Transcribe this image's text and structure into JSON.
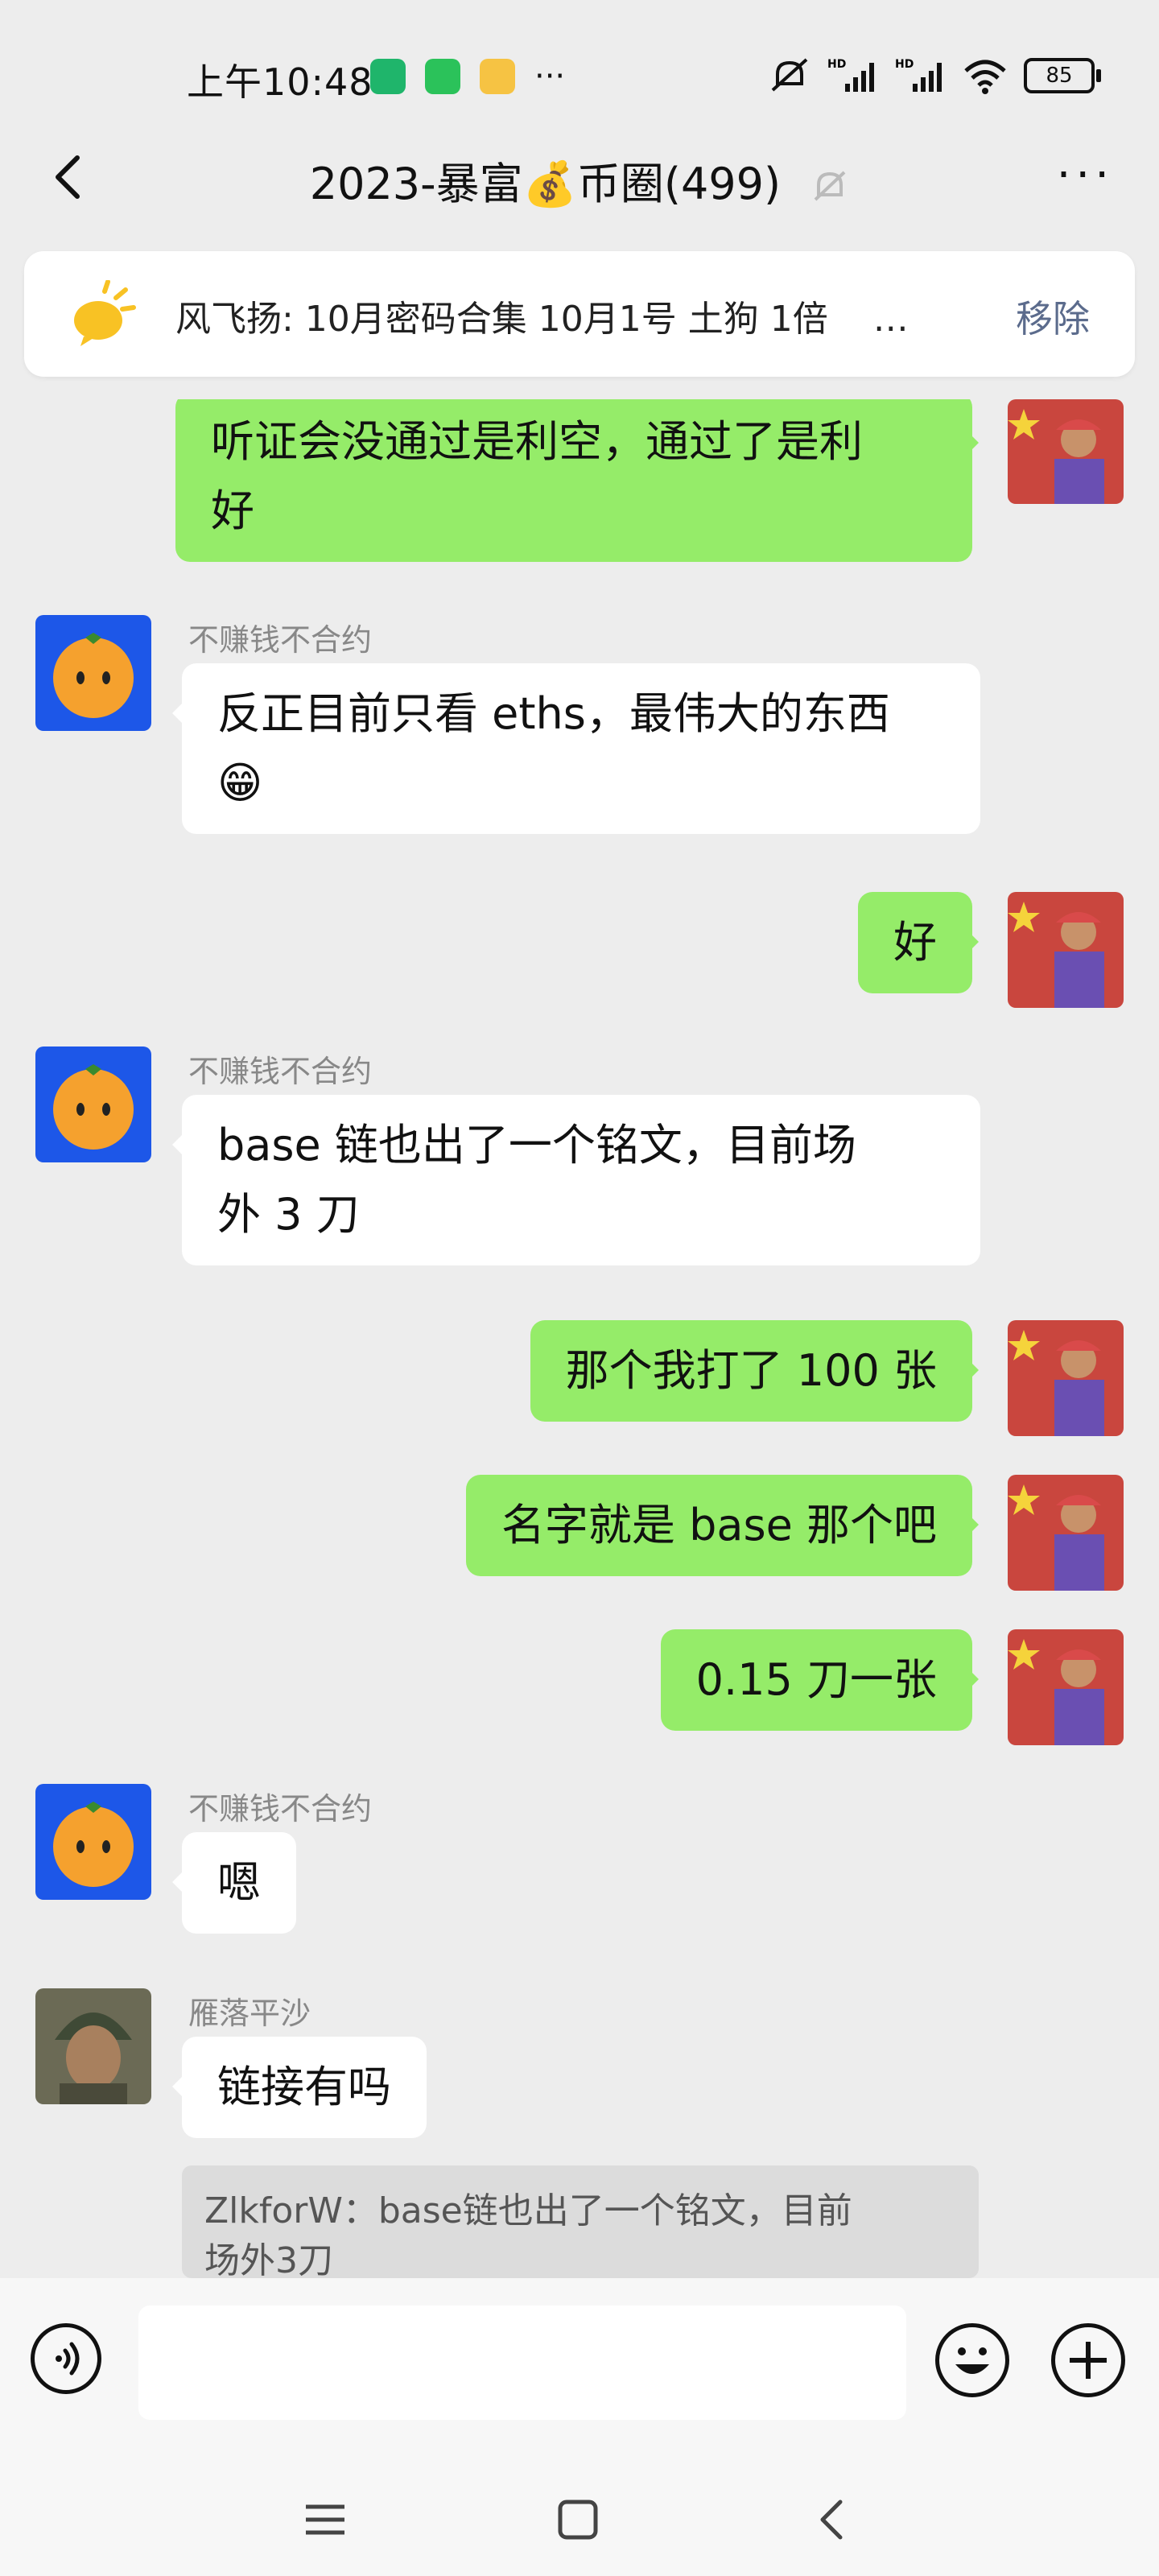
{
  "status_bar": {
    "time": "上午10:48",
    "dots": "···",
    "battery": "85",
    "icons": [
      "shield-app-icon",
      "wechat-icon",
      "notification-app-icon",
      "mute-icon",
      "hd-signal-icon",
      "hd-signal-icon",
      "wifi-icon",
      "battery-icon"
    ]
  },
  "nav": {
    "title": "2023-暴富💰币圈(499)",
    "back_icon": "chevron-left-icon",
    "more_label": "···",
    "mute_icon": "bell-off-icon"
  },
  "pinned": {
    "text": "风飞扬: 10月密码合集 10月1号  土狗   1倍",
    "ellipsis": "…",
    "remove_label": "移除",
    "icon": "speaker-bulb-icon"
  },
  "messages": [
    {
      "side": "me",
      "lines": [
        "听证会没通过是利空，通过了是利",
        "好"
      ]
    },
    {
      "side": "other",
      "sender": "不赚钱不合约",
      "lines": [
        "反正目前只看 eths，最伟大的东西",
        "😁"
      ]
    },
    {
      "side": "me",
      "lines": [
        "好"
      ]
    },
    {
      "side": "other",
      "sender": "不赚钱不合约",
      "lines": [
        "base 链也出了一个铭文，目前场",
        "外 3 刀"
      ]
    },
    {
      "side": "me",
      "lines": [
        "那个我打了 100 张"
      ]
    },
    {
      "side": "me",
      "lines": [
        "名字就是 base 那个吧"
      ]
    },
    {
      "side": "me",
      "lines": [
        "0.15 刀一张"
      ]
    },
    {
      "side": "other",
      "sender": "不赚钱不合约",
      "lines": [
        "嗯"
      ]
    },
    {
      "side": "other",
      "sender": "雁落平沙",
      "lines": [
        "链接有吗"
      ]
    }
  ],
  "quote": {
    "lines": [
      "ZlkforW：base链也出了一个铭文，目前",
      "场外3刀"
    ]
  },
  "input_bar": {
    "voice_icon": "voice-icon",
    "emoji_icon": "emoji-icon",
    "plus_icon": "plus-icon",
    "input_value": ""
  },
  "system_nav": [
    "menu-icon",
    "home-square-icon",
    "back-triangle-icon"
  ],
  "colors": {
    "my_bubble": "#95ec69",
    "other_bubble": "#ffffff",
    "background": "#ededed",
    "link": "#5b6b8c"
  }
}
